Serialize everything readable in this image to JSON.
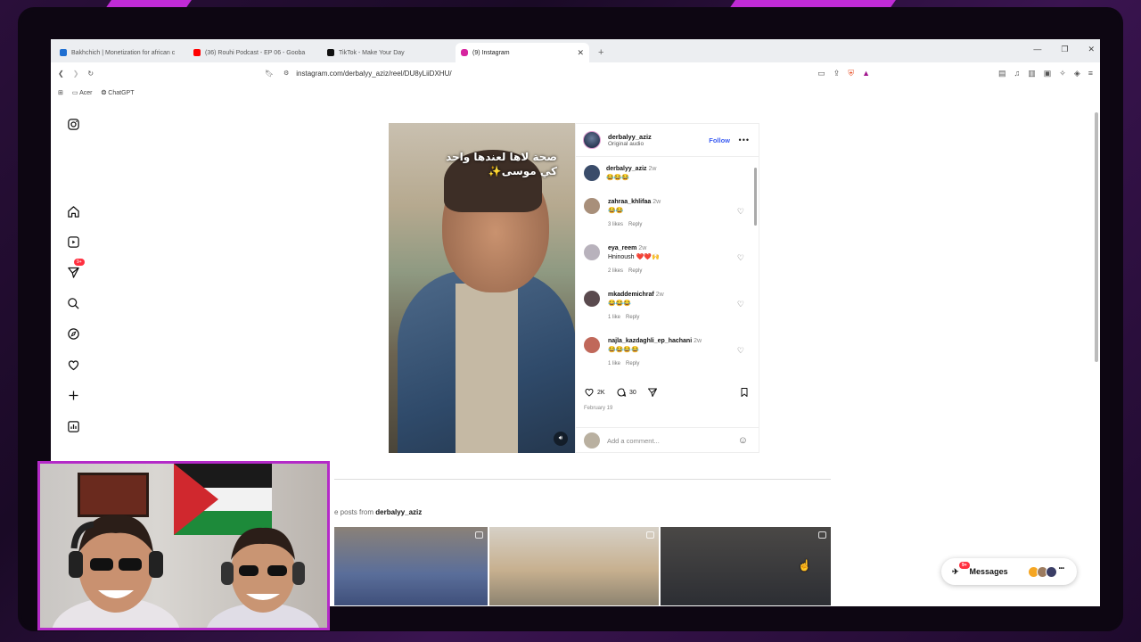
{
  "browser": {
    "tabs": [
      {
        "label": "Bakhchich | Monetization for african c",
        "favicon_color": "#1f6fd1"
      },
      {
        "label": "(36) Rouhi Podcast - EP 06 - Gooba",
        "favicon_color": "#ff0000"
      },
      {
        "label": "TikTok - Make Your Day",
        "favicon_color": "#111111"
      },
      {
        "label": "(9) Instagram",
        "favicon_color": "#d6249f"
      }
    ],
    "new_tab_label": "+",
    "url": "instagram.com/derbalyy_aziz/reel/DU8yLiiDXHU/",
    "bookmarks": [
      "Acer",
      "ChatGPT"
    ]
  },
  "instagram": {
    "nav": {
      "notification_badge": "9+",
      "icons": [
        "instagram-logo-icon",
        "home-icon",
        "reels-icon",
        "direct-icon",
        "search-icon",
        "explore-icon",
        "heart-icon",
        "create-icon",
        "dashboard-icon"
      ]
    },
    "reel": {
      "overlay_line1": "صحة لاها لعندها واحد",
      "overlay_line2": "كي موسى✨"
    },
    "post": {
      "author": "derbalyy_aziz",
      "audio": "Original audio",
      "follow_label": "Follow",
      "more_label": "•••",
      "comments": [
        {
          "user": "derbalyy_aziz",
          "time": "2w",
          "text": "😂😂😂",
          "likes": "",
          "reply": "",
          "avatar_color": "#3a4c6a"
        },
        {
          "user": "zahraa_khlifaa",
          "time": "2w",
          "text": "😂😂",
          "likes": "3 likes",
          "reply": "Reply",
          "avatar_color": "#a88f7a"
        },
        {
          "user": "eya_reem",
          "time": "2w",
          "text": "Hninoush ❤️❤️🙌",
          "likes": "2 likes",
          "reply": "Reply",
          "avatar_color": "#b8b2bc"
        },
        {
          "user": "mkaddemichraf",
          "time": "2w",
          "text": "😂😂😂",
          "likes": "1 like",
          "reply": "Reply",
          "avatar_color": "#5a4a4e"
        },
        {
          "user": "najla_kazdaghli_ep_hachani",
          "time": "2w",
          "text": "😂😂😂😂",
          "likes": "1 like",
          "reply": "Reply",
          "avatar_color": "#c0685a"
        }
      ],
      "likes_count": "2K",
      "comments_count": "30",
      "date": "February 19",
      "add_comment_placeholder": "Add a comment..."
    },
    "more_posts": {
      "prefix": "e posts from",
      "user": "derbalyy_aziz"
    },
    "messages": {
      "label": "Messages",
      "badge": "9+",
      "more": "•••"
    }
  },
  "colors": {
    "accent_blue": "#3c5df2",
    "badge_red": "#ff3040",
    "stream_frame": "#b42ac8"
  }
}
